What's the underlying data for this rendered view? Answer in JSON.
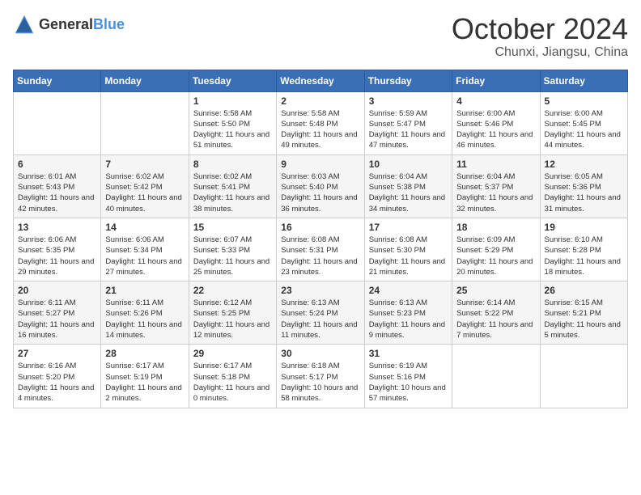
{
  "logo": {
    "general": "General",
    "blue": "Blue"
  },
  "title": "October 2024",
  "subtitle": "Chunxi, Jiangsu, China",
  "weekdays": [
    "Sunday",
    "Monday",
    "Tuesday",
    "Wednesday",
    "Thursday",
    "Friday",
    "Saturday"
  ],
  "weeks": [
    [
      {
        "day": "",
        "info": ""
      },
      {
        "day": "",
        "info": ""
      },
      {
        "day": "1",
        "info": "Sunrise: 5:58 AM\nSunset: 5:50 PM\nDaylight: 11 hours and 51 minutes."
      },
      {
        "day": "2",
        "info": "Sunrise: 5:58 AM\nSunset: 5:48 PM\nDaylight: 11 hours and 49 minutes."
      },
      {
        "day": "3",
        "info": "Sunrise: 5:59 AM\nSunset: 5:47 PM\nDaylight: 11 hours and 47 minutes."
      },
      {
        "day": "4",
        "info": "Sunrise: 6:00 AM\nSunset: 5:46 PM\nDaylight: 11 hours and 46 minutes."
      },
      {
        "day": "5",
        "info": "Sunrise: 6:00 AM\nSunset: 5:45 PM\nDaylight: 11 hours and 44 minutes."
      }
    ],
    [
      {
        "day": "6",
        "info": "Sunrise: 6:01 AM\nSunset: 5:43 PM\nDaylight: 11 hours and 42 minutes."
      },
      {
        "day": "7",
        "info": "Sunrise: 6:02 AM\nSunset: 5:42 PM\nDaylight: 11 hours and 40 minutes."
      },
      {
        "day": "8",
        "info": "Sunrise: 6:02 AM\nSunset: 5:41 PM\nDaylight: 11 hours and 38 minutes."
      },
      {
        "day": "9",
        "info": "Sunrise: 6:03 AM\nSunset: 5:40 PM\nDaylight: 11 hours and 36 minutes."
      },
      {
        "day": "10",
        "info": "Sunrise: 6:04 AM\nSunset: 5:38 PM\nDaylight: 11 hours and 34 minutes."
      },
      {
        "day": "11",
        "info": "Sunrise: 6:04 AM\nSunset: 5:37 PM\nDaylight: 11 hours and 32 minutes."
      },
      {
        "day": "12",
        "info": "Sunrise: 6:05 AM\nSunset: 5:36 PM\nDaylight: 11 hours and 31 minutes."
      }
    ],
    [
      {
        "day": "13",
        "info": "Sunrise: 6:06 AM\nSunset: 5:35 PM\nDaylight: 11 hours and 29 minutes."
      },
      {
        "day": "14",
        "info": "Sunrise: 6:06 AM\nSunset: 5:34 PM\nDaylight: 11 hours and 27 minutes."
      },
      {
        "day": "15",
        "info": "Sunrise: 6:07 AM\nSunset: 5:33 PM\nDaylight: 11 hours and 25 minutes."
      },
      {
        "day": "16",
        "info": "Sunrise: 6:08 AM\nSunset: 5:31 PM\nDaylight: 11 hours and 23 minutes."
      },
      {
        "day": "17",
        "info": "Sunrise: 6:08 AM\nSunset: 5:30 PM\nDaylight: 11 hours and 21 minutes."
      },
      {
        "day": "18",
        "info": "Sunrise: 6:09 AM\nSunset: 5:29 PM\nDaylight: 11 hours and 20 minutes."
      },
      {
        "day": "19",
        "info": "Sunrise: 6:10 AM\nSunset: 5:28 PM\nDaylight: 11 hours and 18 minutes."
      }
    ],
    [
      {
        "day": "20",
        "info": "Sunrise: 6:11 AM\nSunset: 5:27 PM\nDaylight: 11 hours and 16 minutes."
      },
      {
        "day": "21",
        "info": "Sunrise: 6:11 AM\nSunset: 5:26 PM\nDaylight: 11 hours and 14 minutes."
      },
      {
        "day": "22",
        "info": "Sunrise: 6:12 AM\nSunset: 5:25 PM\nDaylight: 11 hours and 12 minutes."
      },
      {
        "day": "23",
        "info": "Sunrise: 6:13 AM\nSunset: 5:24 PM\nDaylight: 11 hours and 11 minutes."
      },
      {
        "day": "24",
        "info": "Sunrise: 6:13 AM\nSunset: 5:23 PM\nDaylight: 11 hours and 9 minutes."
      },
      {
        "day": "25",
        "info": "Sunrise: 6:14 AM\nSunset: 5:22 PM\nDaylight: 11 hours and 7 minutes."
      },
      {
        "day": "26",
        "info": "Sunrise: 6:15 AM\nSunset: 5:21 PM\nDaylight: 11 hours and 5 minutes."
      }
    ],
    [
      {
        "day": "27",
        "info": "Sunrise: 6:16 AM\nSunset: 5:20 PM\nDaylight: 11 hours and 4 minutes."
      },
      {
        "day": "28",
        "info": "Sunrise: 6:17 AM\nSunset: 5:19 PM\nDaylight: 11 hours and 2 minutes."
      },
      {
        "day": "29",
        "info": "Sunrise: 6:17 AM\nSunset: 5:18 PM\nDaylight: 11 hours and 0 minutes."
      },
      {
        "day": "30",
        "info": "Sunrise: 6:18 AM\nSunset: 5:17 PM\nDaylight: 10 hours and 58 minutes."
      },
      {
        "day": "31",
        "info": "Sunrise: 6:19 AM\nSunset: 5:16 PM\nDaylight: 10 hours and 57 minutes."
      },
      {
        "day": "",
        "info": ""
      },
      {
        "day": "",
        "info": ""
      }
    ]
  ]
}
